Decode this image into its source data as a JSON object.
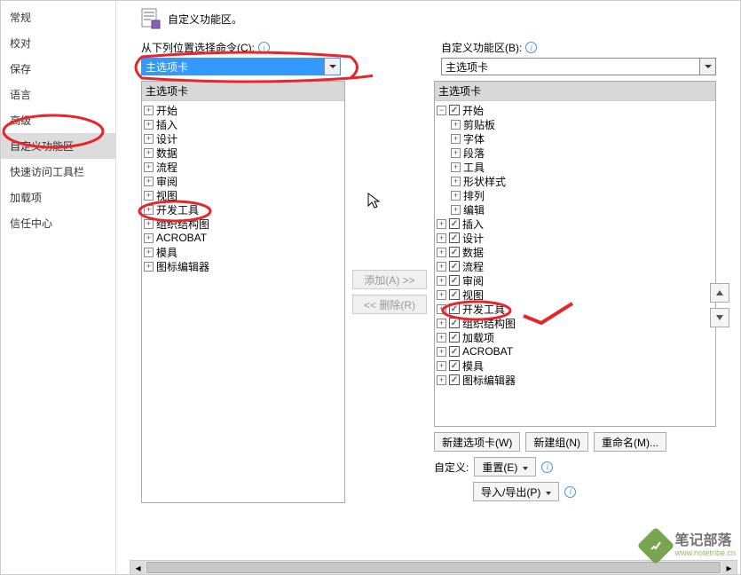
{
  "sidebar": {
    "items": [
      "常规",
      "校对",
      "保存",
      "语言",
      "高级",
      "自定义功能区",
      "快速访问工具栏",
      "加载项",
      "信任中心"
    ],
    "selected_index": 5
  },
  "header": {
    "title": "自定义功能区。"
  },
  "left_panel": {
    "label": "从下列位置选择命令(C):",
    "dropdown_value": "主选项卡",
    "tree_header": "主选项卡",
    "items": [
      "开始",
      "插入",
      "设计",
      "数据",
      "流程",
      "审阅",
      "视图",
      "开发工具",
      "组织结构图",
      "ACROBAT",
      "模具",
      "图标编辑器"
    ]
  },
  "mid_buttons": {
    "add": "添加(A) >>",
    "remove": "<< 删除(R)"
  },
  "right_panel": {
    "label": "自定义功能区(B):",
    "dropdown_value": "主选项卡",
    "tree_header": "主选项卡",
    "root_expanded": {
      "label": "开始",
      "children": [
        "剪贴板",
        "字体",
        "段落",
        "工具",
        "形状样式",
        "排列",
        "编辑"
      ]
    },
    "checked_items": [
      "插入",
      "设计",
      "数据",
      "流程",
      "审阅",
      "视图",
      "开发工具",
      "组织结构图",
      "加载项",
      "ACROBAT",
      "模具",
      "图标编辑器"
    ]
  },
  "bottom_buttons": {
    "new_tab": "新建选项卡(W)",
    "new_group": "新建组(N)",
    "rename": "重命名(M)...",
    "custom_label": "自定义:",
    "reset": "重置(E)",
    "import_export": "导入/导出(P)"
  },
  "watermark": {
    "cn": "笔记部落",
    "en": "www.notetribe.cn"
  }
}
